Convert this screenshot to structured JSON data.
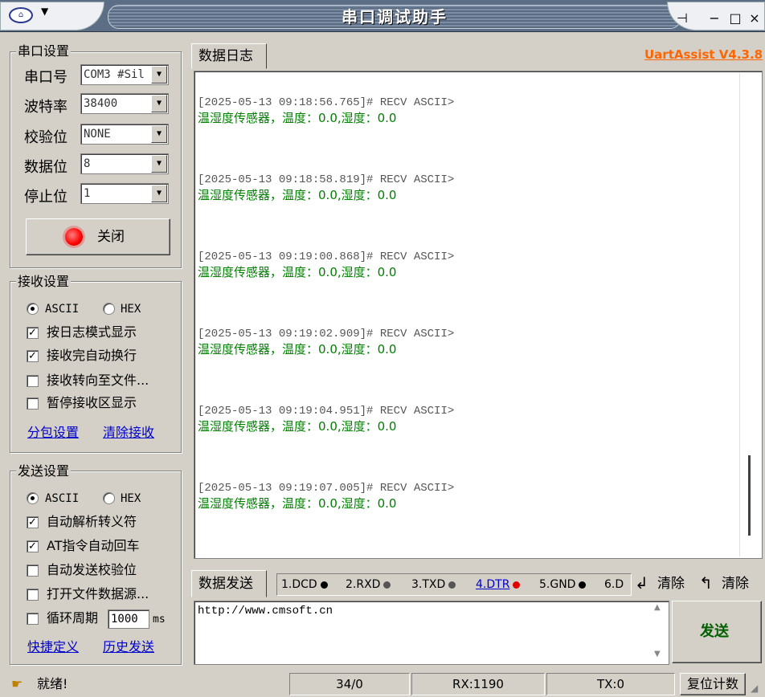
{
  "window": {
    "title": "串口调试助手",
    "controls": [
      "−",
      "□",
      "×"
    ]
  },
  "serial_settings": {
    "title": "串口设置",
    "port_label": "串口号",
    "port_value": "COM3 #Sil",
    "baud_label": "波特率",
    "baud_value": "38400",
    "parity_label": "校验位",
    "parity_value": "NONE",
    "databits_label": "数据位",
    "databits_value": "8",
    "stopbits_label": "停止位",
    "stopbits_value": "1",
    "close_button": "关闭"
  },
  "recv_settings": {
    "title": "接收设置",
    "ascii": "ASCII",
    "hex": "HEX",
    "opt1": "按日志模式显示",
    "opt2": "接收完自动换行",
    "opt3": "接收转向至文件...",
    "opt4": "暂停接收区显示",
    "link1": "分包设置",
    "link2": "清除接收"
  },
  "send_settings": {
    "title": "发送设置",
    "ascii": "ASCII",
    "hex": "HEX",
    "opt1": "自动解析转义符",
    "opt2": "AT指令自动回车",
    "opt3": "自动发送校验位",
    "opt4": "打开文件数据源...",
    "opt5": "循环周期",
    "cycle_value": "1000",
    "cycle_unit": "ms",
    "link1": "快捷定义",
    "link2": "历史发送"
  },
  "log_tab": "数据日志",
  "brand_link": "UartAssist V4.3.8",
  "log_entries": [
    {
      "header": "[2025-05-13 09:18:56.765]# RECV ASCII>",
      "body": "温湿度传感器，温度：0.0,湿度：0.0"
    },
    {
      "header": "[2025-05-13 09:18:58.819]# RECV ASCII>",
      "body": "温湿度传感器，温度：0.0,湿度：0.0"
    },
    {
      "header": "[2025-05-13 09:19:00.868]# RECV ASCII>",
      "body": "温湿度传感器，温度：0.0,湿度：0.0"
    },
    {
      "header": "[2025-05-13 09:19:02.909]# RECV ASCII>",
      "body": "温湿度传感器，温度：0.0,湿度：0.0"
    },
    {
      "header": "[2025-05-13 09:19:04.951]# RECV ASCII>",
      "body": "温湿度传感器，温度：0.0,湿度：0.0"
    },
    {
      "header": "[2025-05-13 09:19:07.005]# RECV ASCII>",
      "body": "温湿度传感器，温度：0.0,湿度：0.0"
    }
  ],
  "send_tab": "数据发送",
  "indicators": {
    "dcd": "1.DCD",
    "rxd": "2.RXD",
    "txd": "3.TXD",
    "dtr": "4.DTR",
    "gnd": "5.GND",
    "dsr": "6.D",
    "clear1": "清除",
    "clear2": "清除"
  },
  "send_text": "http://www.cmsoft.cn",
  "send_button": "发送",
  "status": {
    "ready": "就绪!",
    "count": "34/0",
    "rx": "RX:1190",
    "tx": "TX:0",
    "reset": "复位计数"
  },
  "colors": {
    "recv_text": "#008000",
    "brand": "#ff6600",
    "close_led": "#ff0000"
  }
}
